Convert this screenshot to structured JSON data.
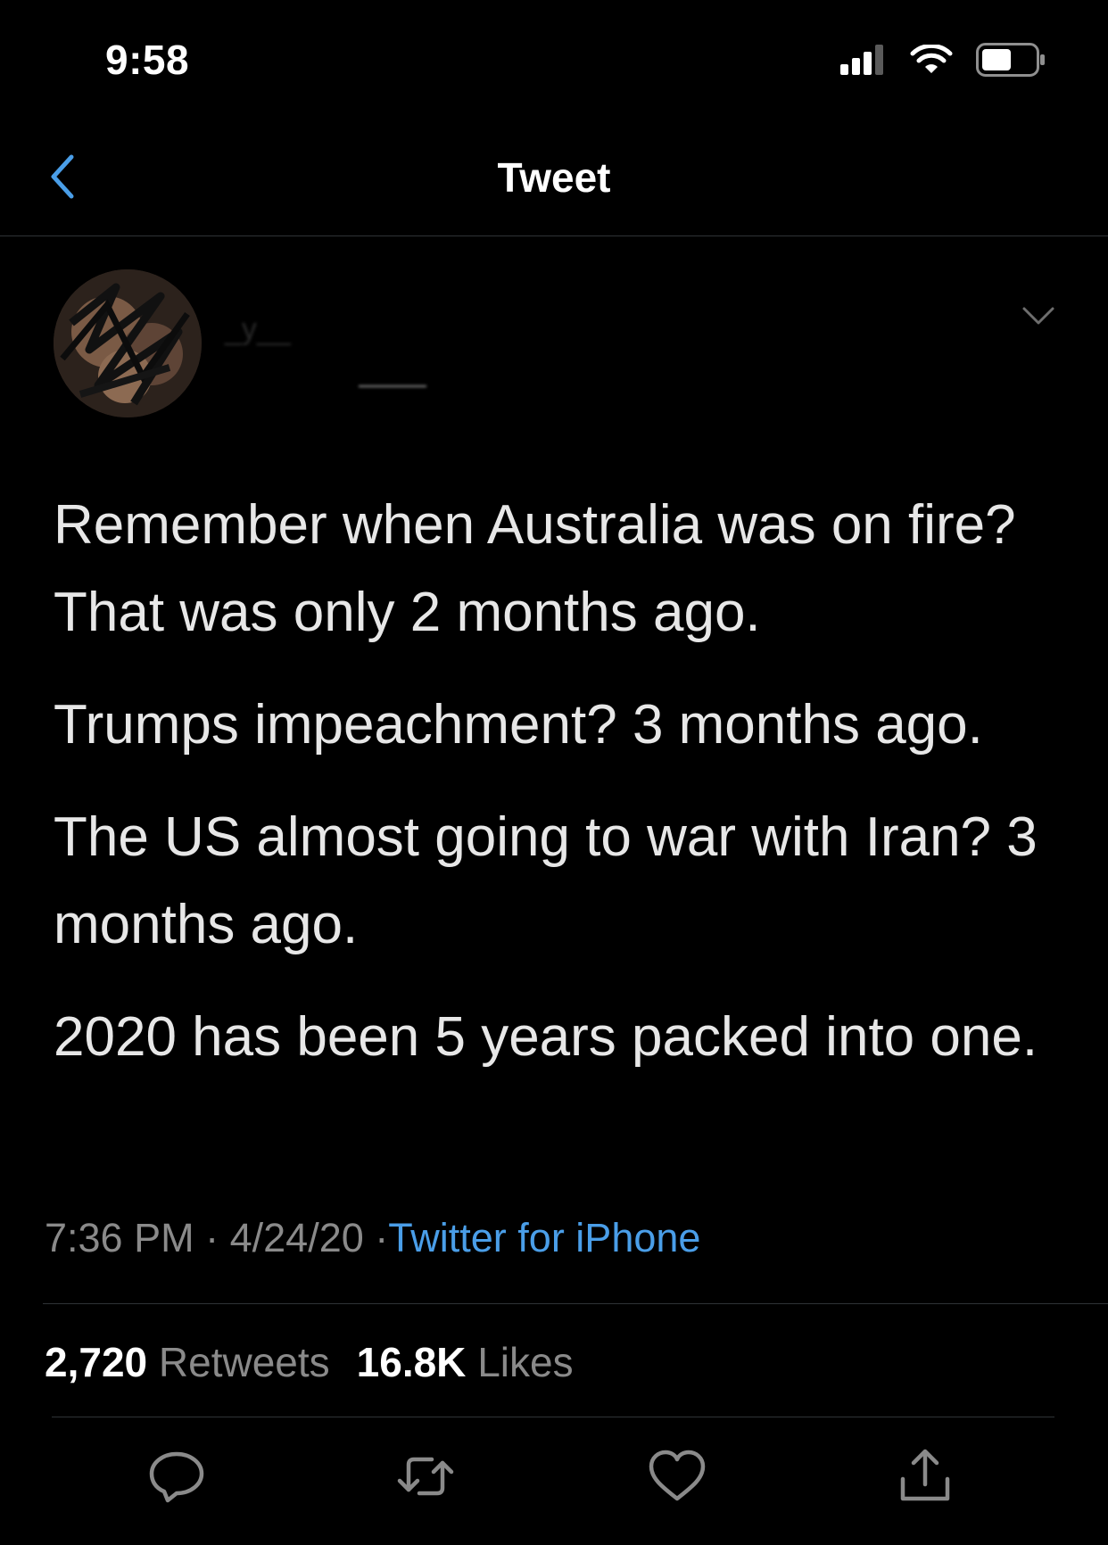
{
  "status_bar": {
    "time": "9:58",
    "icons": [
      "signal-icon",
      "wifi-icon",
      "battery-icon"
    ]
  },
  "header": {
    "title": "Tweet",
    "back_icon": "chevron-left-icon",
    "accent_color": "#4a9ee8"
  },
  "tweet": {
    "author_name": "_y__",
    "menu_icon": "chevron-down-icon",
    "paragraphs": [
      "Remember when Australia was on fire? That was only 2 months ago.",
      "Trumps impeachment? 3 months ago.",
      "The US almost going to war with Iran? 3 months ago.",
      "2020 has been 5 years packed into one."
    ],
    "time": "7:36 PM",
    "date": "4/24/20",
    "source": "Twitter for iPhone",
    "source_color": "#4a9ee8"
  },
  "stats": {
    "retweets_count": "2,720",
    "retweets_label": "Retweets",
    "likes_count": "16.8K",
    "likes_label": "Likes"
  },
  "actions": [
    "reply-icon",
    "retweet-icon",
    "like-icon",
    "share-icon"
  ]
}
